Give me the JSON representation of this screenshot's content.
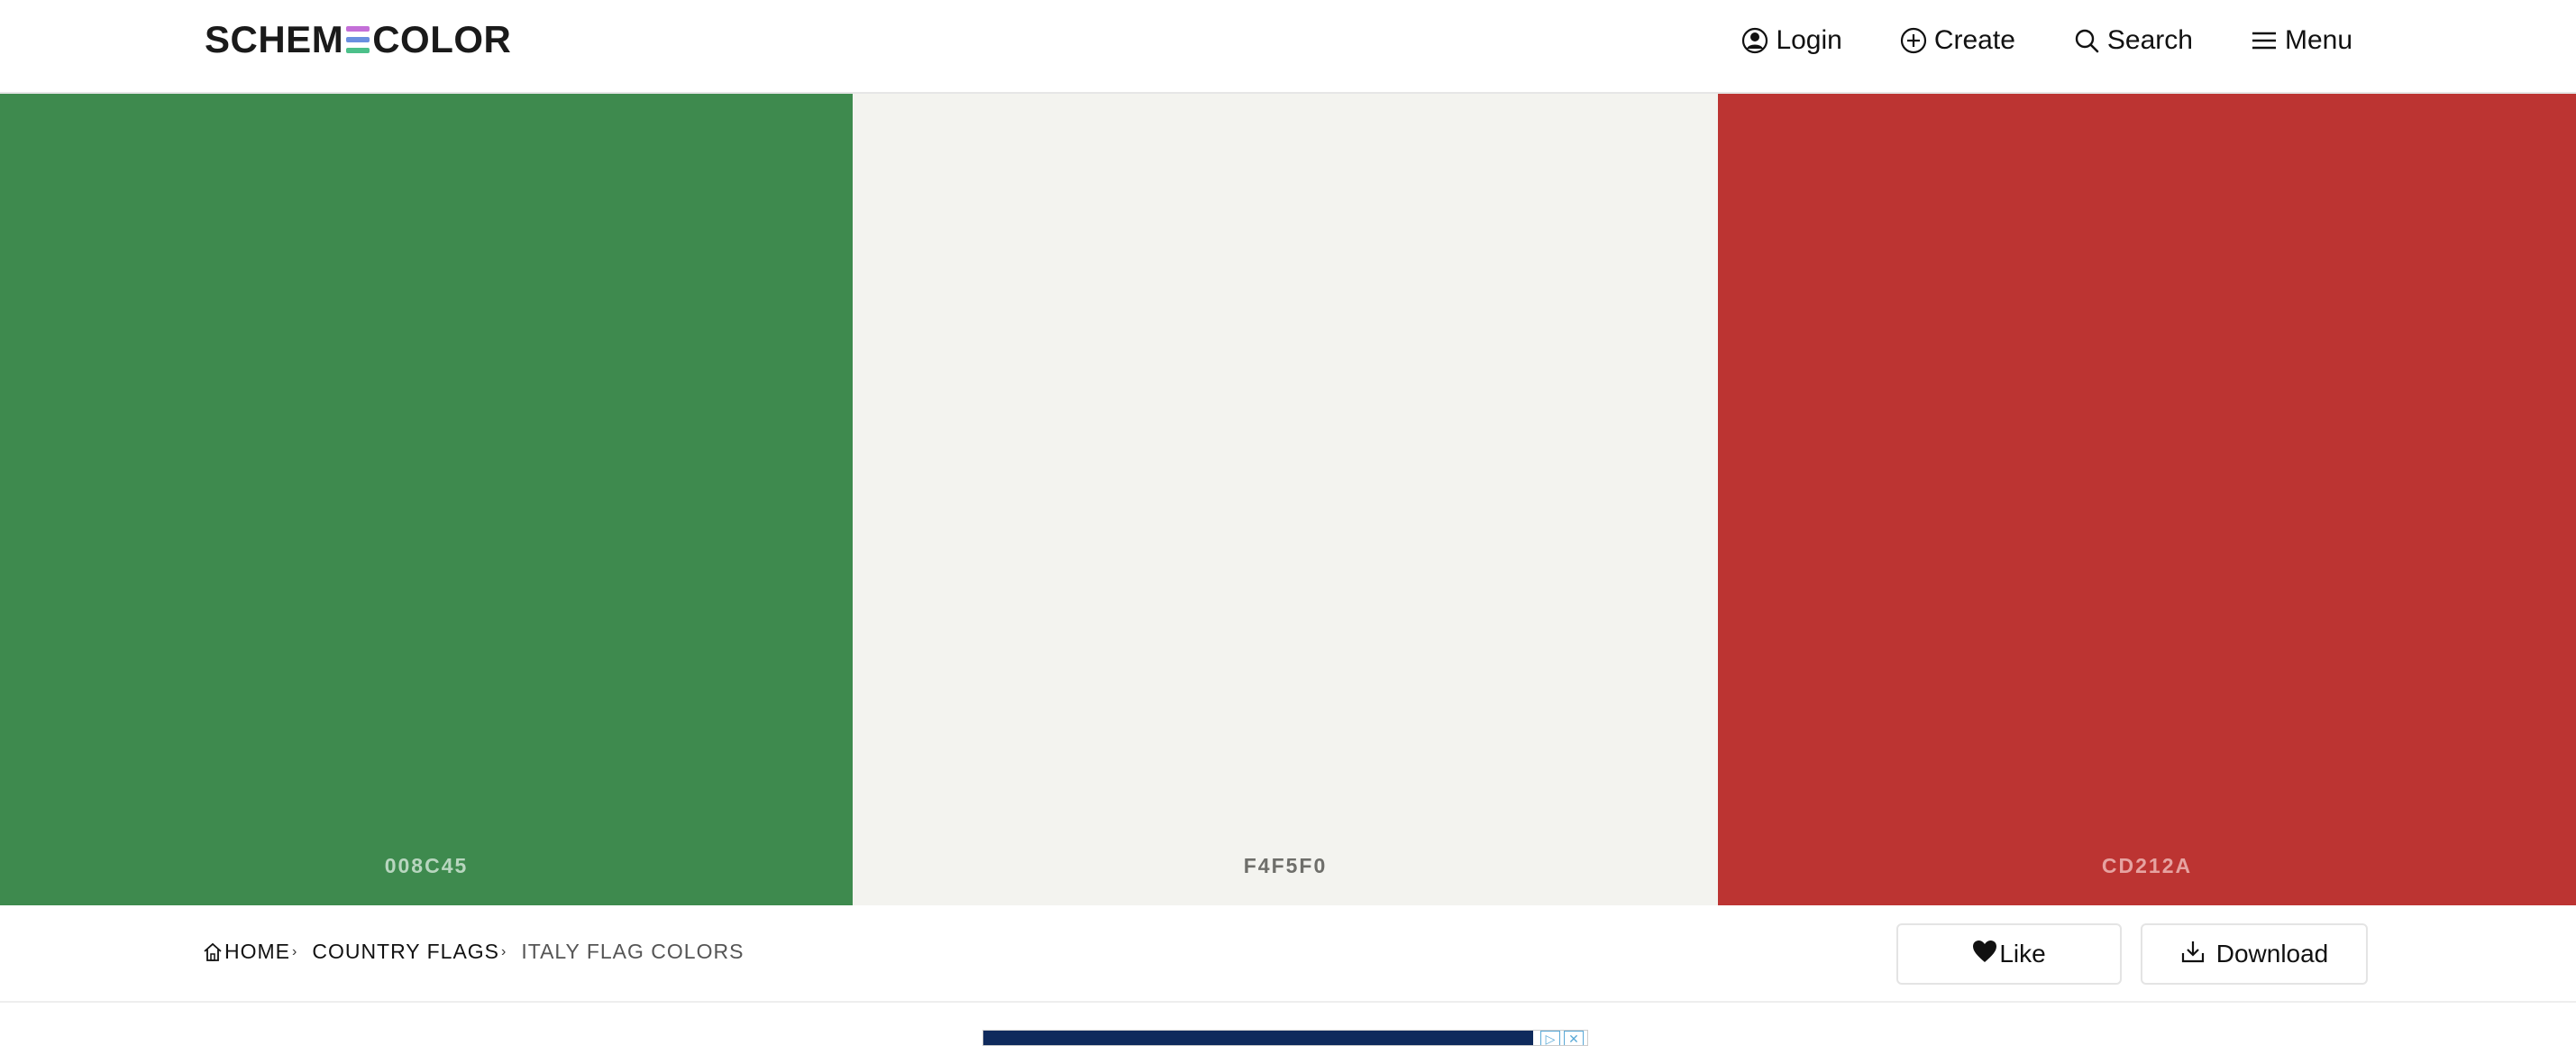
{
  "header": {
    "logo": {
      "text_left": "SCHEM",
      "text_right": "COLOR",
      "e_bar_colors": [
        "#c46fd8",
        "#6a8fe0",
        "#4cc08a"
      ]
    },
    "nav": {
      "login_label": "Login",
      "create_label": "Create",
      "search_label": "Search",
      "menu_label": "Menu"
    }
  },
  "palette": {
    "colors": [
      {
        "hex": "#3E8A4E",
        "code": "008C45",
        "label_color": "#b8d6bf"
      },
      {
        "hex": "#F3F3EF",
        "code": "F4F5F0",
        "label_color": "#6e6e6a"
      },
      {
        "hex": "#BC3432",
        "code": "CD212A",
        "label_color": "#e6a3a1"
      }
    ]
  },
  "breadcrumb": {
    "home": "HOME",
    "section": "COUNTRY FLAGS",
    "current": "ITALY FLAG COLORS"
  },
  "actions": {
    "like_label": "Like",
    "download_label": "Download"
  },
  "ad": {
    "bg_color": "#0f2a5c",
    "icons": [
      "ad-choices-icon",
      "close-icon"
    ]
  }
}
